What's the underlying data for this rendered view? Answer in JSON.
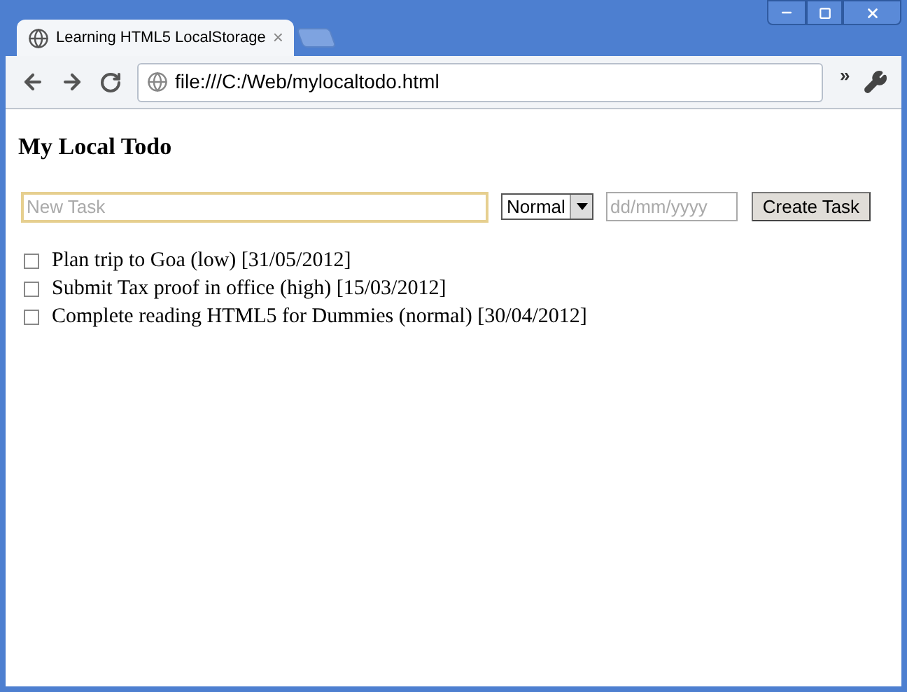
{
  "tab": {
    "title": "Learning HTML5 LocalStorage",
    "close": "×"
  },
  "toolbar": {
    "address": "file:///C:/Web/mylocaltodo.html",
    "more": "»"
  },
  "page": {
    "heading": "My Local Todo",
    "form": {
      "task": {
        "placeholder": "New Task"
      },
      "priority": {
        "value": "Normal"
      },
      "date": {
        "placeholder": "dd/mm/yyyy"
      },
      "button": "Create Task"
    },
    "tasks": [
      {
        "label": "Plan trip to Goa (low) [31/05/2012]",
        "checked": false
      },
      {
        "label": "Submit Tax proof in office (high) [15/03/2012]",
        "checked": false
      },
      {
        "label": "Complete reading HTML5 for Dummies (normal) [30/04/2012]",
        "checked": false
      }
    ]
  }
}
